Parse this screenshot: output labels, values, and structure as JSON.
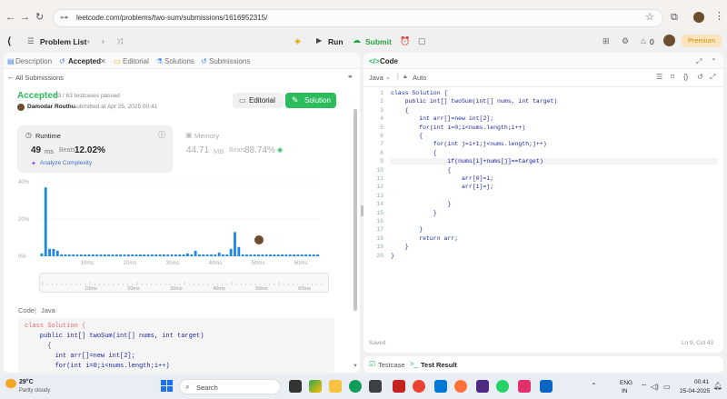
{
  "browser": {
    "url": "leetcode.com/problems/two-sum/submissions/1616952315/"
  },
  "nav": {
    "problem_list": "Problem List",
    "run": "Run",
    "submit": "Submit",
    "premium": "Premium",
    "streak": "0"
  },
  "left_tabs": [
    {
      "label": "Description"
    },
    {
      "label": "Accepted"
    },
    {
      "label": "Editorial"
    },
    {
      "label": "Solutions"
    },
    {
      "label": "Submissions"
    }
  ],
  "submission": {
    "back_link": "All Submissions",
    "status": "Accepted",
    "testcases": "63 / 63 testcases passed",
    "user": "Damodar Routhu",
    "submitted": "submitted at Apr 25, 2025 00:41",
    "editorial_btn": "Editorial",
    "solution_btn": "Solution",
    "runtime_label": "Runtime",
    "runtime_value": "49",
    "runtime_unit": "ms",
    "runtime_beats_label": "Beats",
    "runtime_beats": "12.02%",
    "analyze": "Analyze Complexity",
    "memory_label": "Memory",
    "memory_value": "44.71",
    "memory_unit": "MB",
    "memory_beats_label": "Beats",
    "memory_beats": "88.74%"
  },
  "chart_data": {
    "type": "bar",
    "y_ticks": [
      "40%",
      "20%",
      "0%"
    ],
    "x_ticks": [
      "10ms",
      "20ms",
      "30ms",
      "40ms",
      "50ms",
      "60ms"
    ],
    "ylim": [
      0,
      40
    ],
    "values": [
      1.5,
      37,
      4,
      4,
      3,
      1,
      1,
      1,
      1,
      1,
      1,
      1,
      1,
      1,
      1,
      1,
      1,
      1,
      1,
      1,
      1,
      1,
      1,
      1,
      1,
      1,
      1,
      1,
      1,
      1,
      1,
      1,
      1,
      1,
      1,
      1,
      1,
      1.5,
      1,
      3,
      1,
      1,
      1,
      1,
      1,
      2,
      1,
      1,
      4,
      13,
      5,
      1,
      1,
      1,
      1,
      1,
      1,
      1,
      1,
      1,
      1,
      1,
      1,
      1,
      1,
      1,
      1,
      1,
      1,
      1,
      1
    ],
    "bar_color": "#1e88e5"
  },
  "code_preview": {
    "label": "Code",
    "lang": "Java",
    "lines": [
      "class Solution {",
      "    public int[] twoSum(int[] nums, int target)",
      "      {",
      "        int arr[]=new int[2];",
      "        for(int i=0;i<nums.length;i++)"
    ]
  },
  "editor": {
    "tab_title": "Code",
    "language": "Java",
    "auto": "Auto",
    "saved": "Saved",
    "cursor": "Ln 9, Col 43",
    "lines": [
      "class Solution {",
      "    public int[] twoSum(int[] nums, int target)",
      "    {",
      "        int arr[]=new int[2];",
      "        for(int i=0;i<nums.length;i++)",
      "        {",
      "            for(int j=i+1;j<nums.length;j++)",
      "            {",
      "                if(nums[i]+nums[j]==target)",
      "                {",
      "                    arr[0]=i;",
      "                    arr[1]=j;",
      "",
      "                }",
      "            }",
      "",
      "        }",
      "        return arr;",
      "    }",
      "}"
    ]
  },
  "bottom": {
    "testcase": "Testcase",
    "result": "Test Result"
  },
  "taskbar": {
    "temp": "29°C",
    "weather": "Partly cloudy",
    "search": "Search",
    "lang": "ENG",
    "region": "IN",
    "time": "00:41",
    "date": "25-04-2025"
  }
}
